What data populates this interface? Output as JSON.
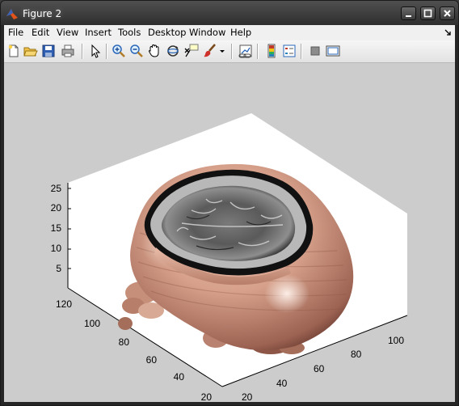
{
  "window": {
    "title": "Figure 2",
    "app_icon": "matlab-logo-icon"
  },
  "menubar": {
    "items": [
      "File",
      "Edit",
      "View",
      "Insert",
      "Tools",
      "Desktop",
      "Window",
      "Help"
    ],
    "dock_icon": "dock-arrow-icon"
  },
  "toolbar": {
    "buttons": [
      "new-figure-icon",
      "open-file-icon",
      "save-icon",
      "print-icon",
      "select-arrow-icon",
      "zoom-in-icon",
      "zoom-out-icon",
      "pan-hand-icon",
      "rotate-3d-icon",
      "data-cursor-icon",
      "brush-icon",
      "brush-dropdown-icon",
      "link-plot-icon",
      "colorbar-icon",
      "legend-icon",
      "hide-plot-tools-icon",
      "show-plot-tools-icon"
    ]
  },
  "axes": {
    "z_ticks": [
      "25",
      "20",
      "15",
      "10",
      "5"
    ],
    "y_ticks": [
      "120",
      "100",
      "80",
      "60",
      "40",
      "20"
    ],
    "x_ticks": [
      "20",
      "40",
      "60",
      "80",
      "100"
    ]
  },
  "chart_data": {
    "type": "isosurface",
    "title": "",
    "xlabel": "",
    "ylabel": "",
    "zlabel": "",
    "xlim": [
      1,
      128
    ],
    "ylim": [
      1,
      128
    ],
    "zlim": [
      1,
      27
    ],
    "x_ticks": [
      20,
      40,
      60,
      80,
      100
    ],
    "y_ticks": [
      20,
      40,
      60,
      80,
      100,
      120
    ],
    "z_ticks": [
      5,
      10,
      15,
      20,
      25
    ],
    "surface_color": "#d4a08c",
    "cap_colormap": "gray",
    "background": "#cccccc",
    "axes_color": "#ffffff",
    "view": "3-D"
  }
}
